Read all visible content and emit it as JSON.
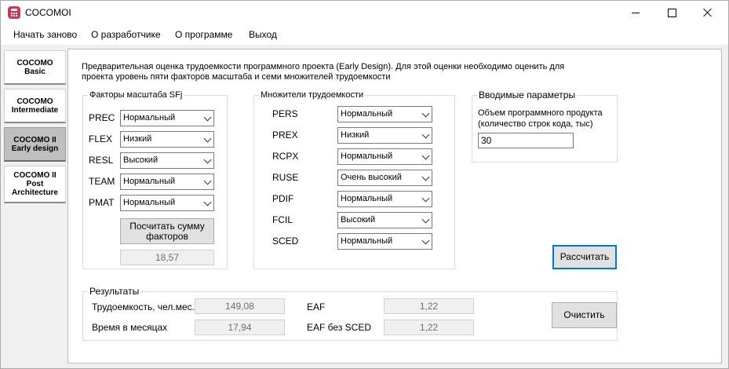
{
  "window": {
    "title": "COCOMOI"
  },
  "menu": [
    "Начать заново",
    "О разработчике",
    "О программе",
    "Выход"
  ],
  "sidebar": [
    {
      "label": "COCOMO\nBasic",
      "active": false
    },
    {
      "label": "COCOMO\nIntermediate",
      "active": false
    },
    {
      "label": "COCOMO II\nEarly design",
      "active": true
    },
    {
      "label": "COCOMO II\nPost\nArchitecture",
      "active": false
    }
  ],
  "intro": {
    "line1": "Предварительная оценка трудоемкости программного проекта (Early Design). Для этой оценки необходимо оценить для",
    "line2": "проекта уровень пяти факторов масштаба и семи множителей трудоемкости"
  },
  "scale_factors": {
    "title": "Факторы масштаба SFj",
    "items": [
      {
        "label": "PREC",
        "value": "Нормальный"
      },
      {
        "label": "FLEX",
        "value": "Низкий"
      },
      {
        "label": "RESL",
        "value": "Высокий"
      },
      {
        "label": "TEAM",
        "value": "Нормальный"
      },
      {
        "label": "PMAT",
        "value": "Нормальный"
      }
    ],
    "button": "Посчитать сумму\nфакторов",
    "sum": "18,57"
  },
  "multipliers": {
    "title": "Множители трудоемкости",
    "items": [
      {
        "label": "PERS",
        "value": "Нормальный"
      },
      {
        "label": "PREX",
        "value": "Низкий"
      },
      {
        "label": "RCPX",
        "value": "Нормальный"
      },
      {
        "label": "RUSE",
        "value": "Очень высокий"
      },
      {
        "label": "PDIF",
        "value": "Нормальный"
      },
      {
        "label": "FCIL",
        "value": "Высокий"
      },
      {
        "label": "SCED",
        "value": "Нормальный"
      }
    ]
  },
  "inputs": {
    "title": "Вводимые параметры",
    "size_label_1": "Объем программного продукта",
    "size_label_2": "(количество строк кода, тыс)",
    "size_value": "30"
  },
  "calculate_button": "Рассчитать",
  "results": {
    "title": "Результаты",
    "effort_label": "Трудоемкость, чел.мес.",
    "effort_value": "149,08",
    "time_label": "Время в месяцах",
    "time_value": "17,94",
    "eaf_label": "EAF",
    "eaf_value": "1,22",
    "eaf_no_sced_label": "EAF без SCED",
    "eaf_no_sced_value": "1,22"
  },
  "clear_button": "Очистить"
}
